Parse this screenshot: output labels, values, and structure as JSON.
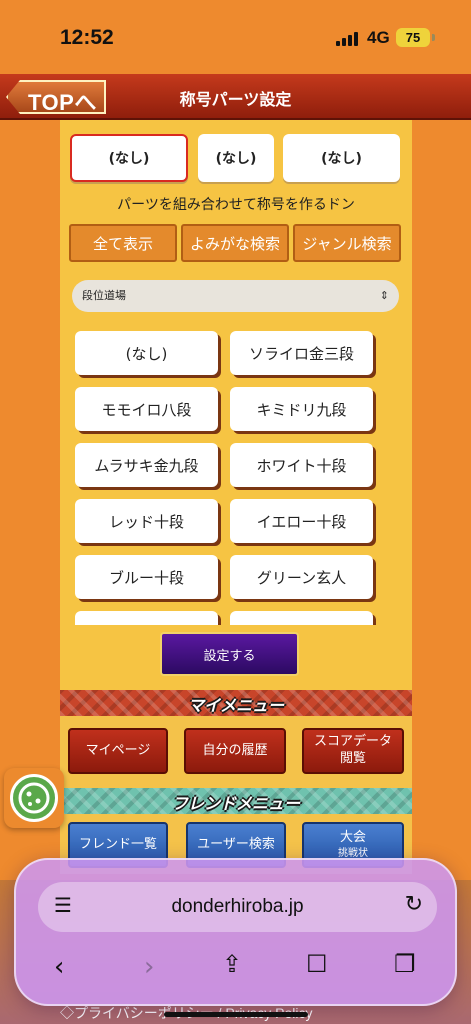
{
  "status": {
    "time": "12:52",
    "network": "4G",
    "battery": "75"
  },
  "header": {
    "back_label": "TOPへ",
    "title": "称号パーツ設定"
  },
  "selection": [
    "(なし)",
    "(なし)",
    "(なし)"
  ],
  "hint": "パーツを組み合わせて称号を作るドン",
  "tabs": [
    "全て表示",
    "よみがな検索",
    "ジャンル検索"
  ],
  "category": {
    "value": "段位道場"
  },
  "options": [
    "(なし)",
    "ソライロ金三段",
    "モモイロ八段",
    "キミドリ九段",
    "ムラサキ金九段",
    "ホワイト十段",
    "レッド十段",
    "イエロー十段",
    "ブルー十段",
    "グリーン玄人",
    "",
    ""
  ],
  "submit_label": "設定する",
  "my_menu": {
    "title": "マイメニュー",
    "items": [
      "マイページ",
      "自分の履歴",
      "スコアデータ",
      "閲覧"
    ]
  },
  "friend_menu": {
    "title": "フレンドメニュー",
    "items": [
      "フレンド一覧",
      "ユーザー検索",
      "大会",
      "挑戦状"
    ]
  },
  "footer": {
    "privacy": "◇プライバシーポリシー / Privacy Policy"
  },
  "safari": {
    "url": "donderhiroba.jp"
  },
  "colors": {
    "background": "#ee8a2e",
    "panel": "#f6c443",
    "submit": "#3a0e80",
    "menu_red": "#a8240f",
    "menu_blue": "#3a6cc0"
  }
}
